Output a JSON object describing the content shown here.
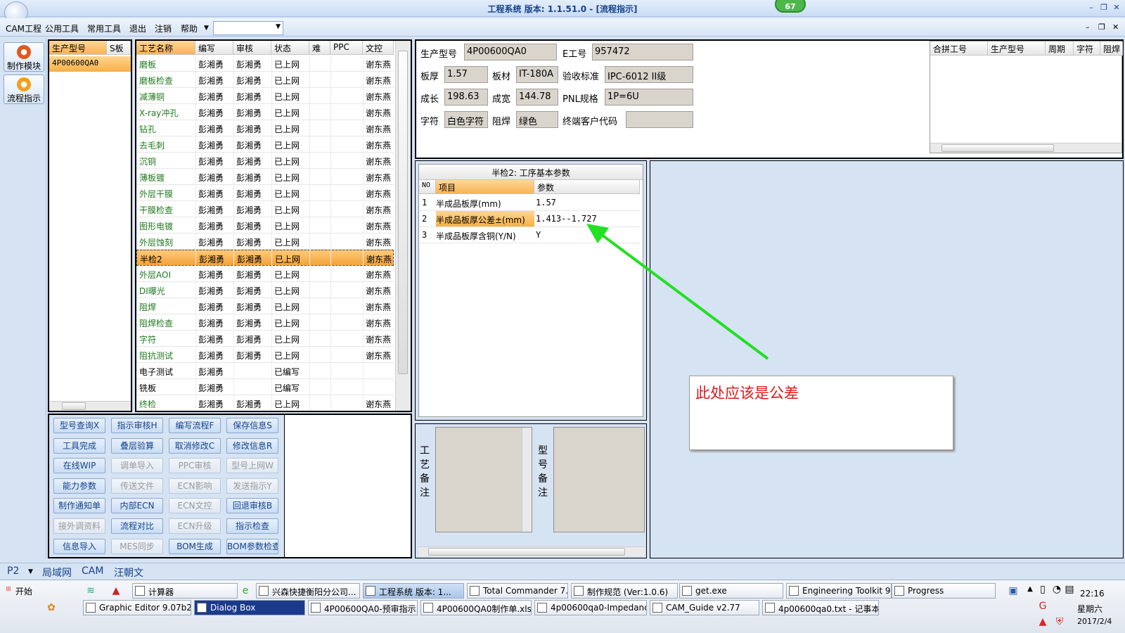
{
  "window": {
    "title": "工程系统  版本: 1.1.51.0 - [流程指示]",
    "badge": "67"
  },
  "menu": {
    "items": [
      "CAM工程",
      "公用工具",
      "常用工具",
      "退出",
      "注销",
      "帮助"
    ],
    "combo_value": ""
  },
  "sidebar": {
    "buttons": [
      "制作模块",
      "流程指示"
    ]
  },
  "models": {
    "headers": [
      "生产型号",
      "S板"
    ],
    "rows": [
      "4P00600QA0"
    ]
  },
  "process": {
    "headers": [
      "工艺名称",
      "编写",
      "审核",
      "状态",
      "难",
      "PPC",
      "文控"
    ],
    "rows": [
      {
        "name": "磨板",
        "writer": "彭湘勇",
        "reviewer": "彭湘勇",
        "status": "已上网",
        "doc": "谢东燕"
      },
      {
        "name": "磨板检查",
        "writer": "彭湘勇",
        "reviewer": "彭湘勇",
        "status": "已上网",
        "doc": "谢东燕"
      },
      {
        "name": "减薄铜",
        "writer": "彭湘勇",
        "reviewer": "彭湘勇",
        "status": "已上网",
        "doc": "谢东燕"
      },
      {
        "name": "X-ray冲孔",
        "writer": "彭湘勇",
        "reviewer": "彭湘勇",
        "status": "已上网",
        "doc": "谢东燕"
      },
      {
        "name": "钻孔",
        "writer": "彭湘勇",
        "reviewer": "彭湘勇",
        "status": "已上网",
        "doc": "谢东燕"
      },
      {
        "name": "去毛刺",
        "writer": "彭湘勇",
        "reviewer": "彭湘勇",
        "status": "已上网",
        "doc": "谢东燕"
      },
      {
        "name": "沉铜",
        "writer": "彭湘勇",
        "reviewer": "彭湘勇",
        "status": "已上网",
        "doc": "谢东燕"
      },
      {
        "name": "薄板镀",
        "writer": "彭湘勇",
        "reviewer": "彭湘勇",
        "status": "已上网",
        "doc": "谢东燕"
      },
      {
        "name": "外层干膜",
        "writer": "彭湘勇",
        "reviewer": "彭湘勇",
        "status": "已上网",
        "doc": "谢东燕"
      },
      {
        "name": "干膜检查",
        "writer": "彭湘勇",
        "reviewer": "彭湘勇",
        "status": "已上网",
        "doc": "谢东燕"
      },
      {
        "name": "图形电镀",
        "writer": "彭湘勇",
        "reviewer": "彭湘勇",
        "status": "已上网",
        "doc": "谢东燕"
      },
      {
        "name": "外层蚀刻",
        "writer": "彭湘勇",
        "reviewer": "彭湘勇",
        "status": "已上网",
        "doc": "谢东燕"
      },
      {
        "name": "半检2",
        "writer": "彭湘勇",
        "reviewer": "彭湘勇",
        "status": "已上网",
        "doc": "谢东燕"
      },
      {
        "name": "外层AOI",
        "writer": "彭湘勇",
        "reviewer": "彭湘勇",
        "status": "已上网",
        "doc": "谢东燕"
      },
      {
        "name": "DI曝光",
        "writer": "彭湘勇",
        "reviewer": "彭湘勇",
        "status": "已上网",
        "doc": "谢东燕"
      },
      {
        "name": "阻焊",
        "writer": "彭湘勇",
        "reviewer": "彭湘勇",
        "status": "已上网",
        "doc": "谢东燕"
      },
      {
        "name": "阻焊检查",
        "writer": "彭湘勇",
        "reviewer": "彭湘勇",
        "status": "已上网",
        "doc": "谢东燕"
      },
      {
        "name": "字符",
        "writer": "彭湘勇",
        "reviewer": "彭湘勇",
        "status": "已上网",
        "doc": "谢东燕"
      },
      {
        "name": "阻抗测试",
        "writer": "彭湘勇",
        "reviewer": "彭湘勇",
        "status": "已上网",
        "doc": "谢东燕"
      },
      {
        "name": "电子测试",
        "writer": "彭湘勇",
        "reviewer": "",
        "status": "已编写",
        "doc": ""
      },
      {
        "name": "铣板",
        "writer": "彭湘勇",
        "reviewer": "",
        "status": "已编写",
        "doc": ""
      },
      {
        "name": "终检",
        "writer": "彭湘勇",
        "reviewer": "彭湘勇",
        "status": "已上网",
        "doc": "谢东燕"
      }
    ]
  },
  "actions": [
    [
      "型号查询X",
      "指示审核H",
      "编写流程F",
      "保存信息S"
    ],
    [
      "工具完成",
      "叠层验算",
      "取消修改C",
      "修改信息R"
    ],
    [
      "在线WIP",
      "调单导入",
      "PPC审核",
      "型号上网W"
    ],
    [
      "能力参数",
      "传送文件",
      "ECN影响",
      "发送指示Y"
    ],
    [
      "制作通知单",
      "内部ECN",
      "ECN文控",
      "回退审核B"
    ],
    [
      "接外调资料",
      "流程对比",
      "ECN升级",
      "指示检查"
    ],
    [
      "信息导入",
      "MES同步",
      "BOM生成",
      "BOM参数检查"
    ]
  ],
  "info": {
    "model_label": "生产型号",
    "model_value": "4P00600QA0",
    "e_label": "E工号",
    "e_value": "957472",
    "thick_label": "板厚",
    "thick_value": "1.57",
    "mat_label": "板材",
    "mat_value": "IT-180A",
    "std_label": "验收标准",
    "std_value": "IPC-6012 II级",
    "len_label": "成长",
    "len_value": "198.63",
    "wid_label": "成宽",
    "wid_value": "144.78",
    "pnl_label": "PNL规格",
    "pnl_value": "1P=6U",
    "char_label": "字符",
    "char_value": "白色字符",
    "mask_label": "阻焊",
    "mask_value": "绿色",
    "cust_label": "终端客户代码",
    "cust_value": ""
  },
  "merge_grid": {
    "headers": [
      "合拼工号",
      "生产型号",
      "周期",
      "字符",
      "阻焊"
    ]
  },
  "params": {
    "title": "半检2: 工序基本参数",
    "headers": [
      "NO",
      "项目",
      "参数"
    ],
    "rows": [
      {
        "no": "1",
        "item": "半成品板厚(mm)",
        "value": "1.57"
      },
      {
        "no": "2",
        "item": "半成品板厚公差±(mm)",
        "value": "1.413--1.727"
      },
      {
        "no": "3",
        "item": "半成品板厚含铜(Y/N)",
        "value": "Y"
      }
    ]
  },
  "remarks": {
    "process_label": "工艺备注",
    "model_label": "型号备注"
  },
  "annotation": "此处应该是公差",
  "tabs": {
    "page": "P2",
    "items": [
      "局域网",
      "CAM",
      "汪朝文"
    ]
  },
  "taskbar": {
    "start": "开始",
    "row1": [
      "计算器",
      "兴森快捷衡阳分公司...",
      "工程系统  版本: 1...",
      "Total Commander 7.0 ...",
      "制作规范 (Ver:1.0.6)",
      "get.exe",
      "Engineering Toolkit 9....",
      "Progress"
    ],
    "row2": [
      "Graphic Editor 9.07b2 (0...",
      "Dialog Box",
      "4P00600QA0-预审指示...",
      "4P00600QA0制作单.xls ...",
      "4p00600qa0-Impedance ...",
      "CAM_Guide v2.77",
      "4p00600qa0.txt - 记事本"
    ],
    "clock": "22:16",
    "weekday": "星期六",
    "date": "2017/2/4"
  }
}
